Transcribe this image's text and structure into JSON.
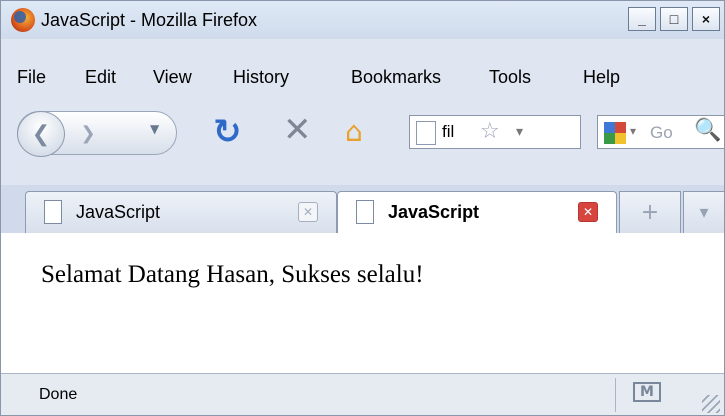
{
  "window": {
    "title": "JavaScript - Mozilla Firefox"
  },
  "window_controls": {
    "minimize": "_",
    "maximize": "□",
    "close": "×"
  },
  "menu": [
    "File",
    "Edit",
    "View",
    "History",
    "Bookmarks",
    "Tools",
    "Help"
  ],
  "nav": {
    "url": "fil",
    "search_placeholder": "Go"
  },
  "tabs": [
    {
      "label": "JavaScript",
      "active": false
    },
    {
      "label": "JavaScript",
      "active": true
    }
  ],
  "content": {
    "text": "Selamat Datang Hasan, Sukses selalu!"
  },
  "status": {
    "text": "Done"
  }
}
